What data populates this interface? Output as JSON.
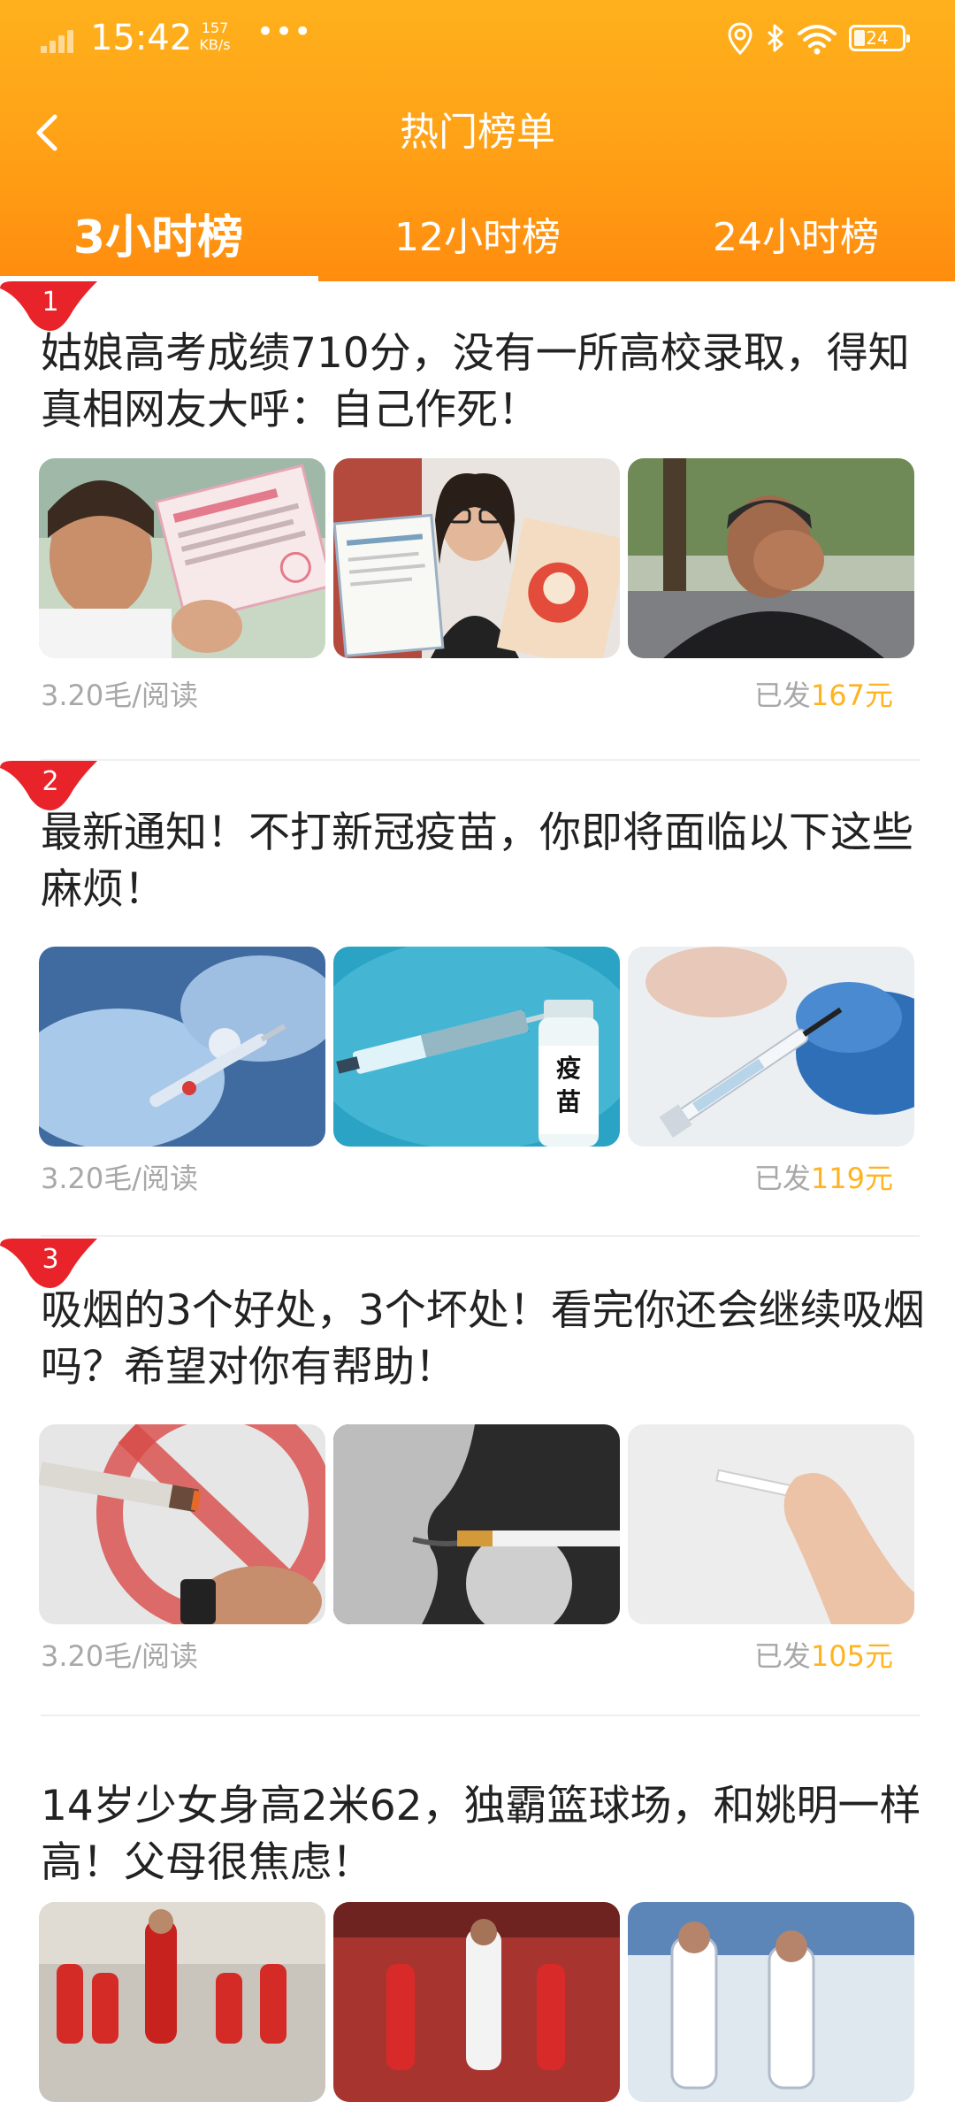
{
  "status_bar": {
    "time": "15:42",
    "net_speed_value": "157",
    "net_speed_unit": "KB/s",
    "more_icon": "•••",
    "battery_level": "24"
  },
  "nav": {
    "back_icon": "chevron-left-icon",
    "title": "热门榜单"
  },
  "tabs": [
    {
      "label": "3小时榜",
      "active": true
    },
    {
      "label": "12小时榜",
      "active": false
    },
    {
      "label": "24小时榜",
      "active": false
    }
  ],
  "articles": [
    {
      "rank": "1",
      "title": "姑娘高考成绩710分，没有一所高校录取，得知真相网友大呼：自己作死！",
      "rate": "3.20毛/阅读",
      "paid_label": "已发",
      "paid_amount": "167元",
      "images": [
        "girl-with-admission-letter-photo",
        "woman-holding-certificate-photo",
        "man-covering-face-photo"
      ]
    },
    {
      "rank": "2",
      "title": "最新通知！不打新冠疫苗，你即将面临以下这些麻烦！",
      "rate": "3.20毛/阅读",
      "paid_label": "已发",
      "paid_amount": "119元",
      "images": [
        "gloved-hands-vaccine-photo",
        "syringe-and-vaccine-vial-photo",
        "syringe-close-up-photo"
      ],
      "vial_label": "疫苗"
    },
    {
      "rank": "3",
      "title": "吸烟的3个好处，3个坏处！看完你还会继续吸烟吗？希望对你有帮助！",
      "rate": "3.20毛/阅读",
      "paid_label": "已发",
      "paid_amount": "105元",
      "images": [
        "no-smoking-sign-photo",
        "person-smoking-photo",
        "hand-holding-cigarette-photo"
      ]
    },
    {
      "rank": "",
      "title": "14岁少女身高2米62，独霸篮球场，和姚明一样高！父母很焦虑！",
      "images": [
        "girls-basketball-team-photo",
        "basketball-game-photo",
        "basketball-players-photo"
      ]
    }
  ],
  "colors": {
    "header_top": "#ffb11c",
    "header_bottom": "#ff8c0e",
    "rank_badge": "#e8242a",
    "paid_amount": "#ffb31f",
    "meta_text": "#a8a8a8"
  }
}
